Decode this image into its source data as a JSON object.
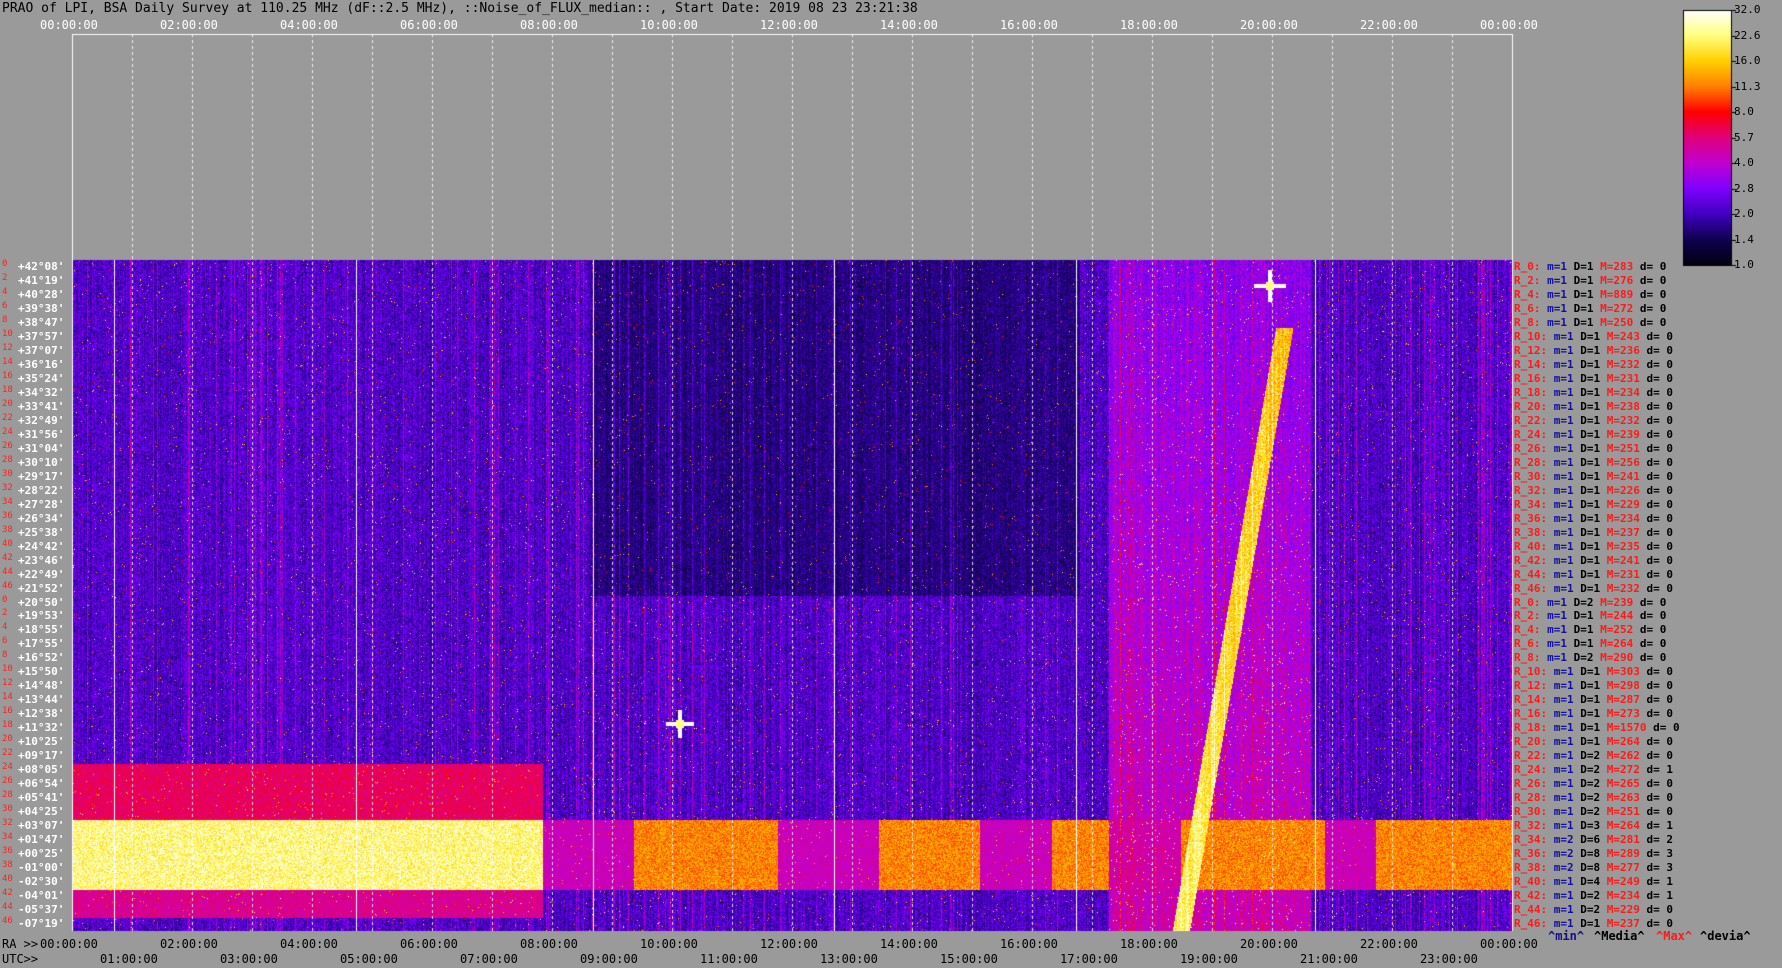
{
  "title": "PRAO of LPI, BSA Daily Survey at 110.25 MHz (dF::2.5 MHz), ::Noise_of_FLUX_median:: , Start Date: 2019 08 23 23:21:38",
  "top_axis_ticks": [
    "00:00:00",
    "02:00:00",
    "04:00:00",
    "06:00:00",
    "08:00:00",
    "10:00:00",
    "12:00:00",
    "14:00:00",
    "16:00:00",
    "18:00:00",
    "20:00:00",
    "22:00:00",
    "00:00:00"
  ],
  "ra_axis": {
    "label": "RA >>",
    "ticks": [
      "00:00:00",
      "02:00:00",
      "04:00:00",
      "06:00:00",
      "08:00:00",
      "10:00:00",
      "12:00:00",
      "14:00:00",
      "16:00:00",
      "18:00:00",
      "20:00:00",
      "22:00:00",
      "00:00:00"
    ]
  },
  "utc_axis": {
    "label": "UTC>>",
    "ticks": [
      "01:00:00",
      "03:00:00",
      "05:00:00",
      "07:00:00",
      "09:00:00",
      "11:00:00",
      "13:00:00",
      "15:00:00",
      "17:00:00",
      "19:00:00",
      "21:00:00",
      "23:00:00"
    ]
  },
  "legend_labels": {
    "min": "^min^",
    "media": "^Media^",
    "max": "^Max^",
    "devia": "^devia^"
  },
  "colorbar": {
    "ticks": [
      "32.0",
      "22.6",
      "16.0",
      "11.3",
      "8.0",
      "5.7",
      "4.0",
      "2.8",
      "2.0",
      "1.4",
      "1.0"
    ],
    "colors": [
      "#ffffff",
      "#ffff80",
      "#ffd000",
      "#ff8000",
      "#ff0000",
      "#e0007a",
      "#c000d0",
      "#8000ff",
      "#4000c0",
      "#100050",
      "#000010"
    ]
  },
  "chart_data": {
    "type": "heatmap",
    "rows": [
      {
        "num": "0",
        "dec": "+42°08'",
        "R": "R_0:",
        "m": "1",
        "D": "1",
        "M": "283",
        "d": "0"
      },
      {
        "num": "2",
        "dec": "+41°19'",
        "R": "R_2:",
        "m": "1",
        "D": "1",
        "M": "276",
        "d": "0"
      },
      {
        "num": "4",
        "dec": "+40°28'",
        "R": "R_4:",
        "m": "1",
        "D": "1",
        "M": "889",
        "d": "0"
      },
      {
        "num": "6",
        "dec": "+39°38'",
        "R": "R_6:",
        "m": "1",
        "D": "1",
        "M": "272",
        "d": "0"
      },
      {
        "num": "8",
        "dec": "+38°47'",
        "R": "R_8:",
        "m": "1",
        "D": "1",
        "M": "250",
        "d": "0"
      },
      {
        "num": "10",
        "dec": "+37°57'",
        "R": "R_10:",
        "m": "1",
        "D": "1",
        "M": "243",
        "d": "0"
      },
      {
        "num": "12",
        "dec": "+37°07'",
        "R": "R_12:",
        "m": "1",
        "D": "1",
        "M": "236",
        "d": "0"
      },
      {
        "num": "14",
        "dec": "+36°16'",
        "R": "R_14:",
        "m": "1",
        "D": "1",
        "M": "232",
        "d": "0"
      },
      {
        "num": "16",
        "dec": "+35°24'",
        "R": "R_16:",
        "m": "1",
        "D": "1",
        "M": "231",
        "d": "0"
      },
      {
        "num": "18",
        "dec": "+34°32'",
        "R": "R_18:",
        "m": "1",
        "D": "1",
        "M": "234",
        "d": "0"
      },
      {
        "num": "20",
        "dec": "+33°41'",
        "R": "R_20:",
        "m": "1",
        "D": "1",
        "M": "238",
        "d": "0"
      },
      {
        "num": "22",
        "dec": "+32°49'",
        "R": "R_22:",
        "m": "1",
        "D": "1",
        "M": "232",
        "d": "0"
      },
      {
        "num": "24",
        "dec": "+31°56'",
        "R": "R_24:",
        "m": "1",
        "D": "1",
        "M": "239",
        "d": "0"
      },
      {
        "num": "26",
        "dec": "+31°04'",
        "R": "R_26:",
        "m": "1",
        "D": "1",
        "M": "251",
        "d": "0"
      },
      {
        "num": "28",
        "dec": "+30°10'",
        "R": "R_28:",
        "m": "1",
        "D": "1",
        "M": "256",
        "d": "0"
      },
      {
        "num": "30",
        "dec": "+29°17'",
        "R": "R_30:",
        "m": "1",
        "D": "1",
        "M": "241",
        "d": "0"
      },
      {
        "num": "32",
        "dec": "+28°22'",
        "R": "R_32:",
        "m": "1",
        "D": "1",
        "M": "226",
        "d": "0"
      },
      {
        "num": "34",
        "dec": "+27°28'",
        "R": "R_34:",
        "m": "1",
        "D": "1",
        "M": "229",
        "d": "0"
      },
      {
        "num": "36",
        "dec": "+26°34'",
        "R": "R_36:",
        "m": "1",
        "D": "1",
        "M": "234",
        "d": "0"
      },
      {
        "num": "38",
        "dec": "+25°38'",
        "R": "R_38:",
        "m": "1",
        "D": "1",
        "M": "237",
        "d": "0"
      },
      {
        "num": "40",
        "dec": "+24°42'",
        "R": "R_40:",
        "m": "1",
        "D": "1",
        "M": "235",
        "d": "0"
      },
      {
        "num": "42",
        "dec": "+23°46'",
        "R": "R_42:",
        "m": "1",
        "D": "1",
        "M": "241",
        "d": "0"
      },
      {
        "num": "44",
        "dec": "+22°49'",
        "R": "R_44:",
        "m": "1",
        "D": "1",
        "M": "231",
        "d": "0"
      },
      {
        "num": "46",
        "dec": "+21°52'",
        "R": "R_46:",
        "m": "1",
        "D": "1",
        "M": "232",
        "d": "0"
      },
      {
        "num": "0",
        "dec": "+20°50'",
        "R": "R_0:",
        "m": "1",
        "D": "2",
        "M": "239",
        "d": "0"
      },
      {
        "num": "2",
        "dec": "+19°53'",
        "R": "R_2:",
        "m": "1",
        "D": "1",
        "M": "244",
        "d": "0"
      },
      {
        "num": "4",
        "dec": "+18°55'",
        "R": "R_4:",
        "m": "1",
        "D": "1",
        "M": "252",
        "d": "0"
      },
      {
        "num": "6",
        "dec": "+17°55'",
        "R": "R_6:",
        "m": "1",
        "D": "1",
        "M": "264",
        "d": "0"
      },
      {
        "num": "8",
        "dec": "+16°52'",
        "R": "R_8:",
        "m": "1",
        "D": "2",
        "M": "290",
        "d": "0"
      },
      {
        "num": "10",
        "dec": "+15°50'",
        "R": "R_10:",
        "m": "1",
        "D": "1",
        "M": "303",
        "d": "0"
      },
      {
        "num": "12",
        "dec": "+14°48'",
        "R": "R_12:",
        "m": "1",
        "D": "1",
        "M": "298",
        "d": "0"
      },
      {
        "num": "14",
        "dec": "+13°44'",
        "R": "R_14:",
        "m": "1",
        "D": "1",
        "M": "287",
        "d": "0"
      },
      {
        "num": "16",
        "dec": "+12°38'",
        "R": "R_16:",
        "m": "1",
        "D": "1",
        "M": "273",
        "d": "0"
      },
      {
        "num": "18",
        "dec": "+11°32'",
        "R": "R_18:",
        "m": "1",
        "D": "1",
        "M": "1570",
        "d": "0"
      },
      {
        "num": "20",
        "dec": "+10°25'",
        "R": "R_20:",
        "m": "1",
        "D": "1",
        "M": "264",
        "d": "0"
      },
      {
        "num": "22",
        "dec": "+09°17'",
        "R": "R_22:",
        "m": "1",
        "D": "2",
        "M": "262",
        "d": "0"
      },
      {
        "num": "24",
        "dec": "+08°05'",
        "R": "R_24:",
        "m": "1",
        "D": "2",
        "M": "272",
        "d": "1"
      },
      {
        "num": "26",
        "dec": "+06°54'",
        "R": "R_26:",
        "m": "1",
        "D": "2",
        "M": "265",
        "d": "0"
      },
      {
        "num": "28",
        "dec": "+05°41'",
        "R": "R_28:",
        "m": "1",
        "D": "2",
        "M": "263",
        "d": "0"
      },
      {
        "num": "30",
        "dec": "+04°25'",
        "R": "R_30:",
        "m": "1",
        "D": "2",
        "M": "251",
        "d": "0"
      },
      {
        "num": "32",
        "dec": "+03°07'",
        "R": "R_32:",
        "m": "1",
        "D": "3",
        "M": "264",
        "d": "1"
      },
      {
        "num": "34",
        "dec": "+01°47'",
        "R": "R_34:",
        "m": "2",
        "D": "6",
        "M": "281",
        "d": "2"
      },
      {
        "num": "36",
        "dec": "+00°25'",
        "R": "R_36:",
        "m": "2",
        "D": "8",
        "M": "289",
        "d": "3"
      },
      {
        "num": "38",
        "dec": "-01°00'",
        "R": "R_38:",
        "m": "2",
        "D": "8",
        "M": "277",
        "d": "3"
      },
      {
        "num": "40",
        "dec": "-02°30'",
        "R": "R_40:",
        "m": "1",
        "D": "4",
        "M": "249",
        "d": "1"
      },
      {
        "num": "42",
        "dec": "-04°01'",
        "R": "R_42:",
        "m": "1",
        "D": "2",
        "M": "234",
        "d": "1"
      },
      {
        "num": "44",
        "dec": "-05°37'",
        "R": "R_44:",
        "m": "1",
        "D": "2",
        "M": "229",
        "d": "0"
      },
      {
        "num": "46",
        "dec": "-07°19'",
        "R": "R_46:",
        "m": "1",
        "D": "1",
        "M": "237",
        "d": "0"
      }
    ]
  }
}
